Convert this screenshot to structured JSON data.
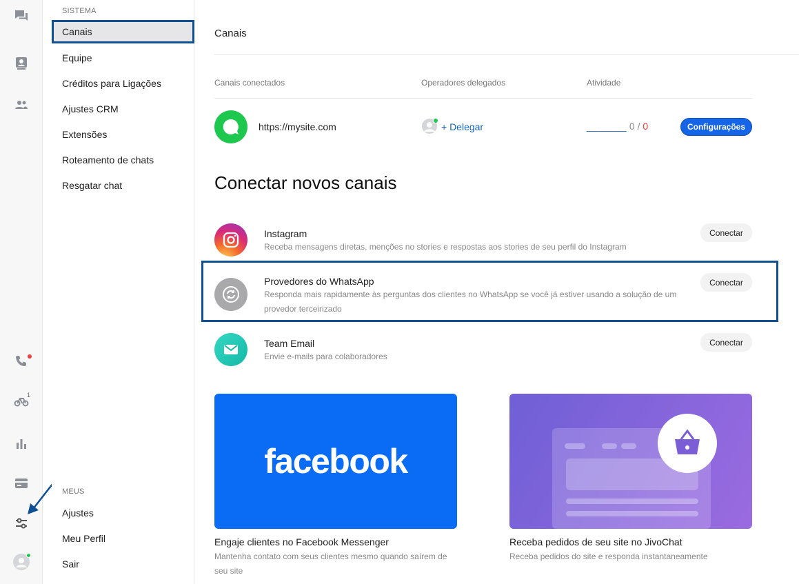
{
  "sidebar": {
    "section_system": "SISTEMA",
    "items": [
      {
        "label": "Canais"
      },
      {
        "label": "Equipe"
      },
      {
        "label": "Créditos para Ligações"
      },
      {
        "label": "Ajustes CRM"
      },
      {
        "label": "Extensões"
      },
      {
        "label": "Roteamento de chats"
      },
      {
        "label": "Resgatar chat"
      }
    ],
    "section_mine": "MEUS",
    "mine_items": [
      {
        "label": "Ajustes"
      },
      {
        "label": "Meu Perfil"
      },
      {
        "label": "Sair"
      }
    ]
  },
  "rail": {
    "icons": [
      "chat-bubbles-icon",
      "contacts-card-icon",
      "team-icon",
      "phone-icon",
      "bike-icon",
      "stats-icon",
      "card-icon",
      "settings-sliders-icon",
      "user-avatar-icon"
    ],
    "badge_count": "1"
  },
  "main": {
    "title": "Canais",
    "columns": {
      "connected": "Canais conectados",
      "operators": "Operadores delegados",
      "activity": "Atividade"
    },
    "connected_channel": {
      "url": "https://mysite.com",
      "delegate": "+ Delegar",
      "activity_dashes": "_______",
      "activity_a": "0",
      "activity_sep": " / ",
      "activity_b": "0",
      "settings_button": "Configurações"
    },
    "new_channels_heading": "Conectar novos canais",
    "channels": [
      {
        "name": "Instagram",
        "desc": "Receba mensagens diretas, menções no stories e respostas aos stories de seu perfil do Instagram",
        "button": "Conectar"
      },
      {
        "name": "Provedores do WhatsApp",
        "desc": "Responda mais rapidamente às perguntas dos clientes no WhatsApp se você já estiver usando a solução de um provedor terceirizado",
        "button": "Conectar"
      },
      {
        "name": "Team Email",
        "desc": "Envie e-mails para colaboradores",
        "button": "Conectar"
      }
    ],
    "cards": [
      {
        "brand": "facebook",
        "title": "Engaje clientes no Facebook Messenger",
        "desc": "Mantenha contato com seus clientes mesmo quando saírem de seu site"
      },
      {
        "title": "Receba pedidos de seu site no JivoChat",
        "desc": "Receba pedidos do site e responda instantaneamente"
      }
    ]
  },
  "colors": {
    "accent": "#1565e6",
    "highlight_border": "#0f4f94",
    "whatsapp_green": "#1ec74e",
    "facebook_blue": "#0a6cf5"
  }
}
